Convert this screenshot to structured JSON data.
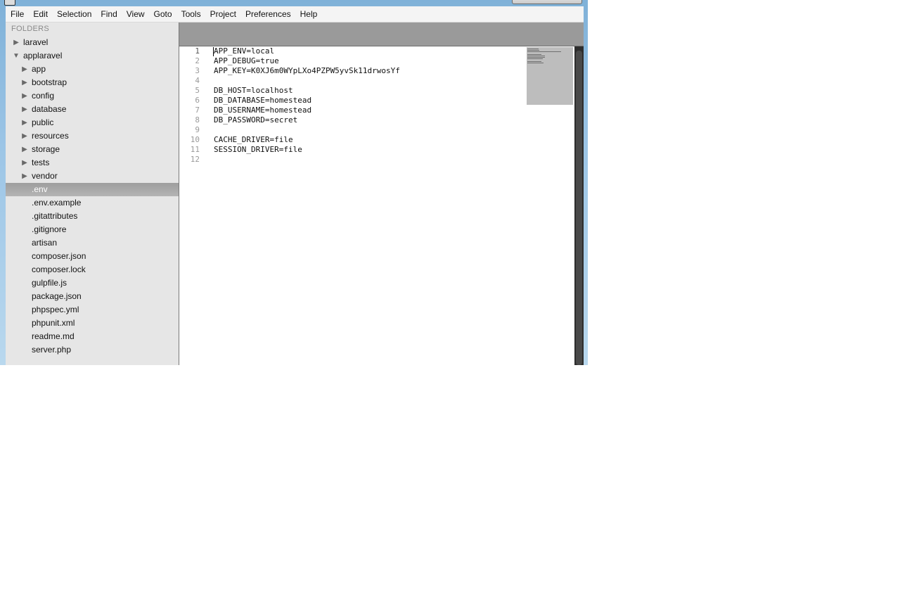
{
  "menu": [
    "File",
    "Edit",
    "Selection",
    "Find",
    "View",
    "Goto",
    "Tools",
    "Project",
    "Preferences",
    "Help"
  ],
  "sidebar": {
    "header": "FOLDERS",
    "tree": [
      {
        "label": "laravel",
        "type": "folder",
        "expanded": false,
        "depth": 0
      },
      {
        "label": "applaravel",
        "type": "folder",
        "expanded": true,
        "depth": 0
      },
      {
        "label": "app",
        "type": "folder",
        "expanded": false,
        "depth": 1
      },
      {
        "label": "bootstrap",
        "type": "folder",
        "expanded": false,
        "depth": 1
      },
      {
        "label": "config",
        "type": "folder",
        "expanded": false,
        "depth": 1
      },
      {
        "label": "database",
        "type": "folder",
        "expanded": false,
        "depth": 1
      },
      {
        "label": "public",
        "type": "folder",
        "expanded": false,
        "depth": 1
      },
      {
        "label": "resources",
        "type": "folder",
        "expanded": false,
        "depth": 1
      },
      {
        "label": "storage",
        "type": "folder",
        "expanded": false,
        "depth": 1
      },
      {
        "label": "tests",
        "type": "folder",
        "expanded": false,
        "depth": 1
      },
      {
        "label": "vendor",
        "type": "folder",
        "expanded": false,
        "depth": 1
      },
      {
        "label": ".env",
        "type": "file",
        "depth": 1,
        "selected": true
      },
      {
        "label": ".env.example",
        "type": "file",
        "depth": 1
      },
      {
        "label": ".gitattributes",
        "type": "file",
        "depth": 1
      },
      {
        "label": ".gitignore",
        "type": "file",
        "depth": 1
      },
      {
        "label": "artisan",
        "type": "file",
        "depth": 1
      },
      {
        "label": "composer.json",
        "type": "file",
        "depth": 1
      },
      {
        "label": "composer.lock",
        "type": "file",
        "depth": 1
      },
      {
        "label": "gulpfile.js",
        "type": "file",
        "depth": 1
      },
      {
        "label": "package.json",
        "type": "file",
        "depth": 1
      },
      {
        "label": "phpspec.yml",
        "type": "file",
        "depth": 1
      },
      {
        "label": "phpunit.xml",
        "type": "file",
        "depth": 1
      },
      {
        "label": "readme.md",
        "type": "file",
        "depth": 1
      },
      {
        "label": "server.php",
        "type": "file",
        "depth": 1
      }
    ]
  },
  "editor": {
    "current_line": 1,
    "lines": [
      "APP_ENV=local",
      "APP_DEBUG=true",
      "APP_KEY=K0XJ6m0WYpLXo4PZPW5yvSk11drwosYf",
      "",
      "DB_HOST=localhost",
      "DB_DATABASE=homestead",
      "DB_USERNAME=homestead",
      "DB_PASSWORD=secret",
      "",
      "CACHE_DRIVER=file",
      "SESSION_DRIVER=file",
      ""
    ]
  },
  "icons": {
    "collapsed": "triangle-right-icon",
    "expanded": "triangle-down-icon"
  },
  "colors": {
    "selection": "#a8a8a8",
    "tabbar": "#9a9a9a",
    "scrollbar": "#2d2d2d"
  }
}
